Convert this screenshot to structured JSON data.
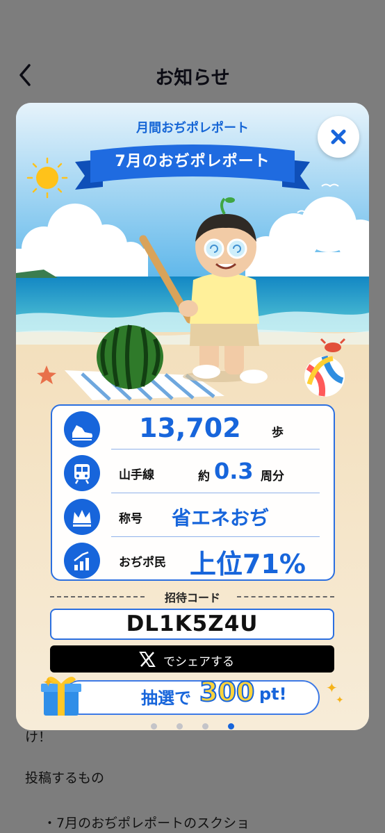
{
  "nav": {
    "title": "お知らせ",
    "back_icon": "chevron-left-icon"
  },
  "background": {
    "line1": "け！",
    "line2": "投稿するもの",
    "line3": "・7月のおぢポレポートのスクショ"
  },
  "modal": {
    "subtitle": "月間おぢポレポート",
    "ribbon_title": "7月のおぢポレポート",
    "close_icon": "close-icon",
    "stats": [
      {
        "icon": "shoe-icon",
        "label": "",
        "prefix": "",
        "value": "13,702",
        "unit": "歩"
      },
      {
        "icon": "train-icon",
        "label": "山手線",
        "prefix": "約",
        "value": "0.3",
        "unit": "周分"
      },
      {
        "icon": "crown-icon",
        "label": "称号",
        "prefix": "",
        "value": "省エネおぢ",
        "unit": ""
      },
      {
        "icon": "rank-chart-icon",
        "label": "おぢポ民",
        "prefix": "",
        "value": "上位71%",
        "unit": ""
      }
    ],
    "invite_label": "招待コード",
    "invite_code": "DL1K5Z4U",
    "share_label": "でシェアする",
    "lottery": {
      "text": "抽選で",
      "amount": "300",
      "unit": "pt!"
    },
    "pagination": {
      "total": 4,
      "active": 4
    }
  },
  "colors": {
    "accent": "#1765db",
    "overlay": "#7d7d7d",
    "gold": "#ffd43b"
  }
}
